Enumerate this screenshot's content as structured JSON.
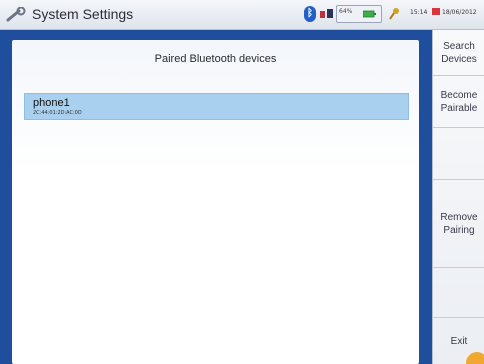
{
  "titlebar": {
    "title": "System Settings",
    "icons": [
      "settings-wrench-icon",
      "bluetooth-icon",
      "network-icon",
      "battery-charging-icon",
      "key-icon",
      "flag-icon"
    ],
    "battery_label": "64%",
    "time": "15:14",
    "date": "18/06/2012"
  },
  "panel": {
    "header": "Paired Bluetooth devices",
    "devices": [
      {
        "name": "phone1",
        "address": "2C:44:01:2D:AC:0D",
        "selected": true
      }
    ]
  },
  "sidebar": {
    "search": "Search\nDevices",
    "become_pairable": "Become\nPairable",
    "empty_1": "",
    "remove_pairing": "Remove\nPairing",
    "empty_2": "",
    "exit": "Exit"
  },
  "colors": {
    "frame": "#1f4f9c",
    "selection": "#a9d0ee",
    "bluetooth": "#2260c8"
  }
}
